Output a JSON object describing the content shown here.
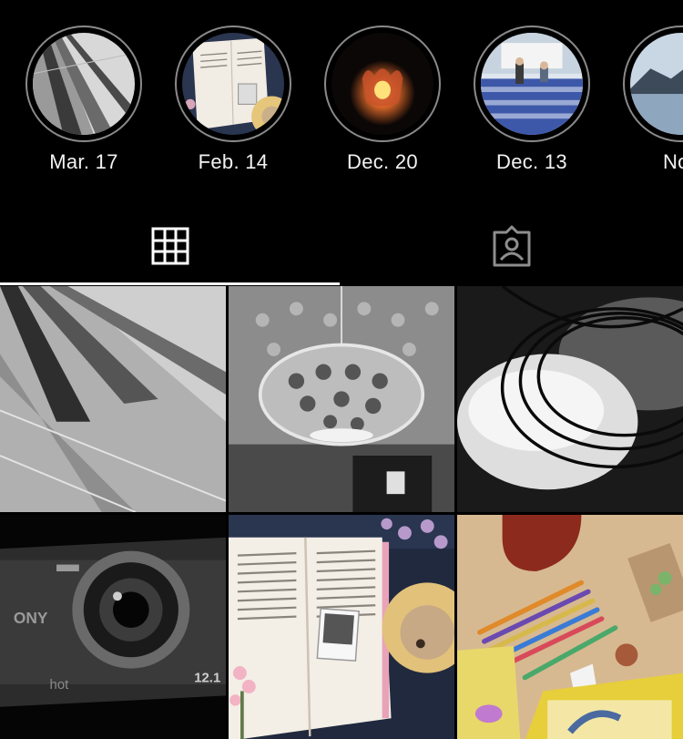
{
  "highlights": [
    {
      "label": "Mar. 17",
      "thumb": "stair-shadows"
    },
    {
      "label": "Feb. 14",
      "thumb": "book-hedgehog"
    },
    {
      "label": "Dec. 20",
      "thumb": "candle"
    },
    {
      "label": "Dec. 13",
      "thumb": "stairs-people"
    },
    {
      "label": "Nov",
      "thumb": "lake"
    }
  ],
  "tabs": [
    {
      "name": "posts-grid",
      "icon": "grid-icon",
      "active": true
    },
    {
      "name": "tagged",
      "icon": "tagged-person-icon",
      "active": false
    }
  ],
  "grid": [
    {
      "thumb": "stair-shadows-bw"
    },
    {
      "thumb": "pendant-lamp-bw"
    },
    {
      "thumb": "egg-wires-bw"
    },
    {
      "thumb": "camera-bw",
      "overlay_text": {
        "brand": "ONY",
        "model": "hot",
        "megapixels": "12.1"
      }
    },
    {
      "thumb": "book-hedgehog"
    },
    {
      "thumb": "guitar-pencils"
    }
  ],
  "colors": {
    "background": "#000000",
    "ring": "#8a8a8a",
    "active_tab": "#ffffff",
    "inactive_tab": "#8e8e8e"
  }
}
